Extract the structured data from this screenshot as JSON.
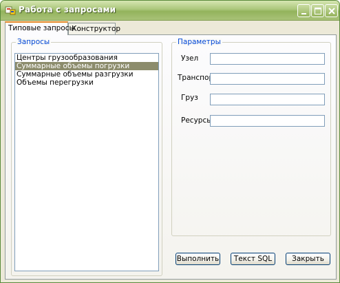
{
  "window": {
    "title": "Работа с запросами"
  },
  "tabs": [
    {
      "label": "Типовые запросы",
      "active": true
    },
    {
      "label": "Конструктор",
      "active": false
    }
  ],
  "queries": {
    "legend": "Запросы",
    "items": [
      {
        "label": "Центры грузообразования",
        "selected": false
      },
      {
        "label": "Суммарные объемы погрузки",
        "selected": true
      },
      {
        "label": "Суммарные объемы разгрузки",
        "selected": false
      },
      {
        "label": "Объемы перегрузки",
        "selected": false
      }
    ]
  },
  "params": {
    "legend": "Параметры",
    "fields": [
      {
        "label": "Узел",
        "value": ""
      },
      {
        "label": "Транспорт",
        "value": ""
      },
      {
        "label": "Груз",
        "value": ""
      },
      {
        "label": "Ресурсы",
        "value": ""
      }
    ]
  },
  "buttons": {
    "execute": "Выполнить",
    "sql": "Текст SQL",
    "close": "Закрыть"
  },
  "colors": {
    "accent_tab": "#e68b2c",
    "legend_text": "#0046d5",
    "selection": "#8c8c6c",
    "titlebar": "#93b35c"
  }
}
